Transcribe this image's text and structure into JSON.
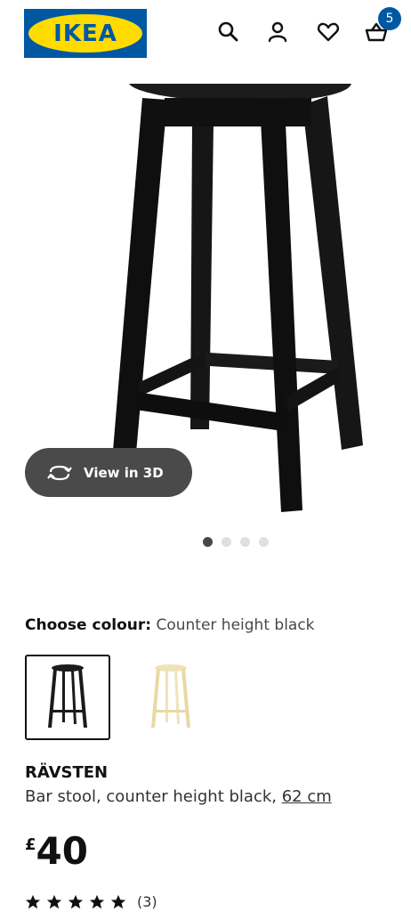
{
  "header": {
    "logo_text": "IKEA",
    "brand_colors": {
      "blue": "#0058a3",
      "yellow": "#ffdb00"
    },
    "icons": [
      "search-icon",
      "user-icon",
      "heart-icon",
      "basket-icon"
    ],
    "cart_count": "5"
  },
  "gallery": {
    "view_3d_label": "View in 3D",
    "image_count": 4,
    "active_index": 0
  },
  "colour": {
    "label": "Choose colour:",
    "selected": "Counter height black",
    "options": [
      {
        "color": "#1b1b1b",
        "selected": true
      },
      {
        "color": "#efe3b8",
        "selected": false
      }
    ]
  },
  "product": {
    "name": "RÄVSTEN",
    "description_prefix": "Bar stool, counter height black,",
    "size_link": "62 cm",
    "price_currency": "£",
    "price_amount": "40",
    "rating_stars": 5,
    "review_count": "(3)"
  }
}
